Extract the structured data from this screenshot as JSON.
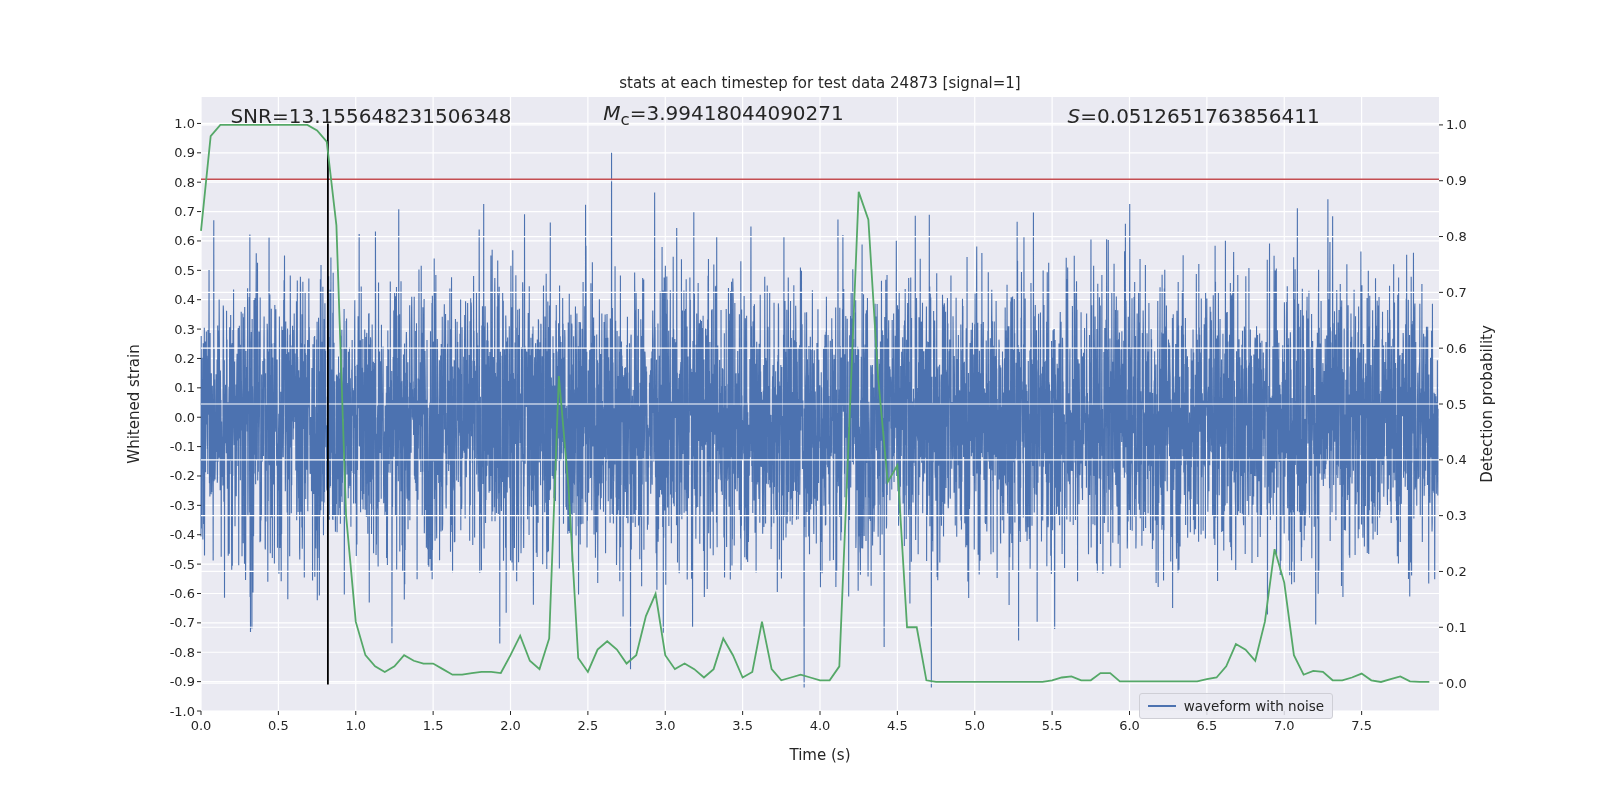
{
  "figure": {
    "chart_data": {
      "type": "line",
      "title": "stats at each timestep for test data 24873 [signal=1]",
      "xlabel": "Time (s)",
      "ylabel": "Whitened strain",
      "y2label": "Detection probability",
      "xlim": [
        0,
        8
      ],
      "ylim": [
        -1.0,
        1.09
      ],
      "y2lim": [
        -0.05,
        1.05
      ],
      "xticks": [
        {
          "value": 0,
          "label": "0.0"
        },
        {
          "value": 0.5,
          "label": "0.5"
        },
        {
          "value": 1,
          "label": "1.0"
        },
        {
          "value": 1.5,
          "label": "1.5"
        },
        {
          "value": 2,
          "label": "2.0"
        },
        {
          "value": 2.5,
          "label": "2.5"
        },
        {
          "value": 3,
          "label": "3.0"
        },
        {
          "value": 3.5,
          "label": "3.5"
        },
        {
          "value": 4,
          "label": "4.0"
        },
        {
          "value": 4.5,
          "label": "4.5"
        },
        {
          "value": 5,
          "label": "5.0"
        },
        {
          "value": 5.5,
          "label": "5.5"
        },
        {
          "value": 6,
          "label": "6.0"
        },
        {
          "value": 6.5,
          "label": "6.5"
        },
        {
          "value": 7,
          "label": "7.0"
        },
        {
          "value": 7.5,
          "label": "7.5"
        }
      ],
      "yticks": [
        {
          "value": -1.0,
          "label": "-1.0"
        },
        {
          "value": -0.9,
          "label": "-0.9"
        },
        {
          "value": -0.8,
          "label": "-0.8"
        },
        {
          "value": -0.7,
          "label": "-0.7"
        },
        {
          "value": -0.6,
          "label": "-0.6"
        },
        {
          "value": -0.5,
          "label": "-0.5"
        },
        {
          "value": -0.4,
          "label": "-0.4"
        },
        {
          "value": -0.3,
          "label": "-0.3"
        },
        {
          "value": -0.2,
          "label": "-0.2"
        },
        {
          "value": -0.1,
          "label": "-0.1"
        },
        {
          "value": 0,
          "label": "0.0"
        },
        {
          "value": 0.1,
          "label": "0.1"
        },
        {
          "value": 0.2,
          "label": "0.2"
        },
        {
          "value": 0.3,
          "label": "0.3"
        },
        {
          "value": 0.4,
          "label": "0.4"
        },
        {
          "value": 0.5,
          "label": "0.5"
        },
        {
          "value": 0.6,
          "label": "0.6"
        },
        {
          "value": 0.7,
          "label": "0.7"
        },
        {
          "value": 0.8,
          "label": "0.8"
        },
        {
          "value": 0.9,
          "label": "0.9"
        },
        {
          "value": 1.0,
          "label": "1.0"
        }
      ],
      "y2ticks": [
        {
          "value": 0,
          "label": "0.0"
        },
        {
          "value": 0.1,
          "label": "0.1"
        },
        {
          "value": 0.2,
          "label": "0.2"
        },
        {
          "value": 0.3,
          "label": "0.3"
        },
        {
          "value": 0.4,
          "label": "0.4"
        },
        {
          "value": 0.5,
          "label": "0.5"
        },
        {
          "value": 0.6,
          "label": "0.6"
        },
        {
          "value": 0.7,
          "label": "0.7"
        },
        {
          "value": 0.8,
          "label": "0.8"
        },
        {
          "value": 0.9,
          "label": "0.9"
        },
        {
          "value": 1.0,
          "label": "1.0"
        }
      ],
      "x": [
        0,
        0.0625,
        0.125,
        0.1875,
        0.25,
        0.3125,
        0.375,
        0.4375,
        0.5,
        0.5625,
        0.625,
        0.6875,
        0.75,
        0.8125,
        0.875,
        0.9375,
        1,
        1.0625,
        1.125,
        1.1875,
        1.25,
        1.3125,
        1.375,
        1.4375,
        1.5,
        1.5625,
        1.625,
        1.6875,
        1.75,
        1.8125,
        1.875,
        1.9375,
        2,
        2.0625,
        2.125,
        2.1875,
        2.25,
        2.3125,
        2.375,
        2.4375,
        2.5,
        2.5625,
        2.625,
        2.6875,
        2.75,
        2.8125,
        2.875,
        2.9375,
        3,
        3.0625,
        3.125,
        3.1875,
        3.25,
        3.3125,
        3.375,
        3.4375,
        3.5,
        3.5625,
        3.625,
        3.6875,
        3.75,
        3.8125,
        3.875,
        3.9375,
        4,
        4.0625,
        4.125,
        4.1875,
        4.25,
        4.3125,
        4.375,
        4.4375,
        4.5,
        4.5625,
        4.625,
        4.6875,
        4.75,
        4.8125,
        4.875,
        4.9375,
        5,
        5.0625,
        5.125,
        5.1875,
        5.25,
        5.3125,
        5.375,
        5.4375,
        5.5,
        5.5625,
        5.625,
        5.6875,
        5.75,
        5.8125,
        5.875,
        5.9375,
        6,
        6.0625,
        6.125,
        6.1875,
        6.25,
        6.3125,
        6.375,
        6.4375,
        6.5,
        6.5625,
        6.625,
        6.6875,
        6.75,
        6.8125,
        6.875,
        6.9375,
        7,
        7.0625,
        7.125,
        7.1875,
        7.25,
        7.3125,
        7.375,
        7.4375,
        7.5,
        7.5625,
        7.625,
        7.6875,
        7.75,
        7.8125,
        7.875,
        7.9375
      ],
      "series": [
        {
          "color": "#55a868",
          "axis": "y2",
          "values": [
            0.81,
            0.98,
            1.0,
            1.0,
            1.0,
            1.0,
            1.0,
            1.0,
            1.0,
            1.0,
            1.0,
            1.0,
            0.99,
            0.97,
            0.82,
            0.3,
            0.11,
            0.05,
            0.03,
            0.02,
            0.03,
            0.05,
            0.04,
            0.035,
            0.035,
            0.025,
            0.015,
            0.015,
            0.018,
            0.02,
            0.02,
            0.018,
            0.05,
            0.085,
            0.04,
            0.025,
            0.08,
            0.55,
            0.35,
            0.045,
            0.02,
            0.06,
            0.075,
            0.06,
            0.035,
            0.05,
            0.12,
            0.16,
            0.05,
            0.025,
            0.035,
            0.025,
            0.01,
            0.025,
            0.08,
            0.05,
            0.01,
            0.02,
            0.11,
            0.025,
            0.005,
            0.01,
            0.015,
            0.01,
            0.005,
            0.005,
            0.03,
            0.45,
            0.88,
            0.83,
            0.55,
            0.36,
            0.39,
            0.1,
            0.1,
            0.005,
            0.002,
            0.002,
            0.002,
            0.002,
            0.002,
            0.002,
            0.002,
            0.002,
            0.002,
            0.002,
            0.002,
            0.002,
            0.005,
            0.01,
            0.012,
            0.005,
            0.005,
            0.018,
            0.018,
            0.003,
            0.003,
            0.003,
            0.003,
            0.003,
            0.003,
            0.003,
            0.003,
            0.003,
            0.007,
            0.01,
            0.03,
            0.07,
            0.06,
            0.04,
            0.11,
            0.24,
            0.18,
            0.05,
            0.015,
            0.022,
            0.02,
            0.005,
            0.005,
            0.01,
            0.017,
            0.005,
            0.002,
            0.007,
            0.012,
            0.003,
            0.002,
            0.002
          ]
        }
      ],
      "grid": true,
      "ref_lines": [
        {
          "axis": "y",
          "value": 0.81,
          "color": "#c44e52"
        },
        {
          "axis": "x",
          "value": 0.82,
          "color": "#000000"
        }
      ],
      "annotations": [
        "SNR=13.155648231506348",
        "*M*$_{c}$=3.99418044090271",
        "*S*=0.0512651763856411"
      ]
    },
    "legend": [
      {
        "label": "waveform with noise",
        "color": "#4c72b0"
      }
    ]
  }
}
